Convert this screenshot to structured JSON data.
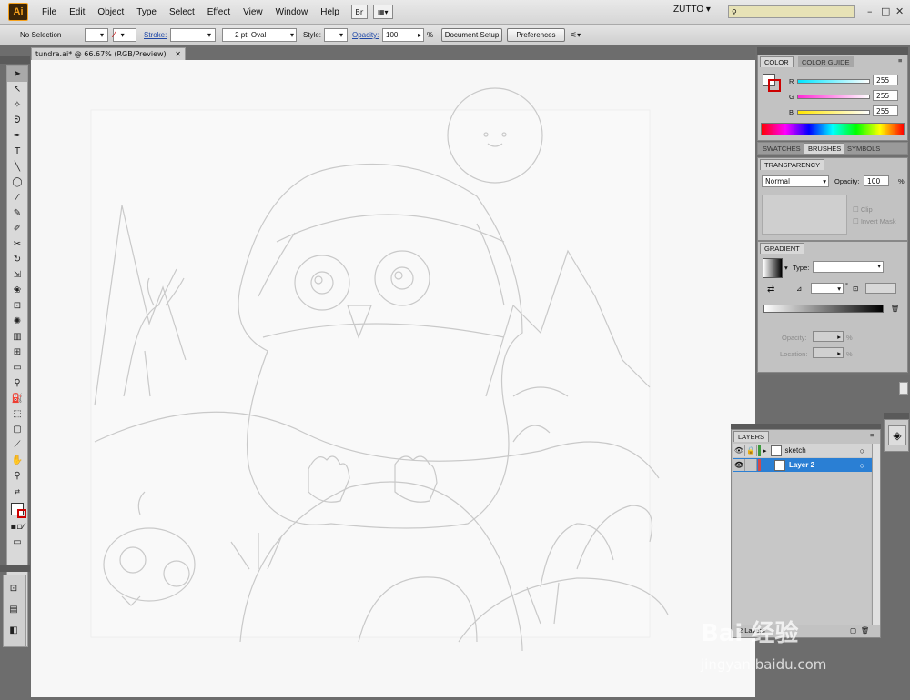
{
  "app_logo": "Ai",
  "menu": [
    "File",
    "Edit",
    "Object",
    "Type",
    "Select",
    "Effect",
    "View",
    "Window",
    "Help"
  ],
  "toolbar_icons": {
    "bridge": "Br"
  },
  "workspace": "ZUTTO",
  "window_controls": {
    "minimize": "–",
    "maximize": "□",
    "close": "✕"
  },
  "control_bar": {
    "selection": "No Selection",
    "stroke_label": "Stroke:",
    "brush": "2 pt. Oval",
    "style_label": "Style:",
    "opacity_label": "Opacity:",
    "opacity_value": "100",
    "opacity_unit": "%",
    "document_setup": "Document Setup",
    "preferences": "Preferences"
  },
  "doc_tab": {
    "title": "tundra.ai* @ 66.67% (RGB/Preview)",
    "close": "✕"
  },
  "color_panel": {
    "tabs": [
      "COLOR",
      "COLOR GUIDE"
    ],
    "channels": [
      {
        "name": "R",
        "value": "255",
        "color": "#d24a4a"
      },
      {
        "name": "G",
        "value": "255",
        "color": "#3fb03f"
      },
      {
        "name": "B",
        "value": "255",
        "color": "#4a5fd2"
      }
    ]
  },
  "swatch_tabs": [
    "SWATCHES",
    "BRUSHES",
    "SYMBOLS"
  ],
  "transparency_panel": {
    "tab": "TRANSPARENCY",
    "mode": "Normal",
    "opacity_label": "Opacity:",
    "opacity_value": "100",
    "opacity_unit": "%",
    "clip": "Clip",
    "invert_mask": "Invert Mask"
  },
  "gradient_panel": {
    "tab": "GRADIENT",
    "type_label": "Type:",
    "opacity_label": "Opacity:",
    "location_label": "Location:",
    "percent_unit": "%",
    "degree_unit": "°"
  },
  "layers_panel": {
    "tab": "LAYERS",
    "layers": [
      {
        "name": "sketch",
        "color": "#3c9a3c",
        "selected": false,
        "locked": true
      },
      {
        "name": "Layer 2",
        "color": "#d24a4a",
        "selected": true,
        "locked": false
      }
    ],
    "footer": "2 Layers"
  },
  "watermark": {
    "text": "Bai 经验",
    "url": "jingyan.baidu.com"
  }
}
